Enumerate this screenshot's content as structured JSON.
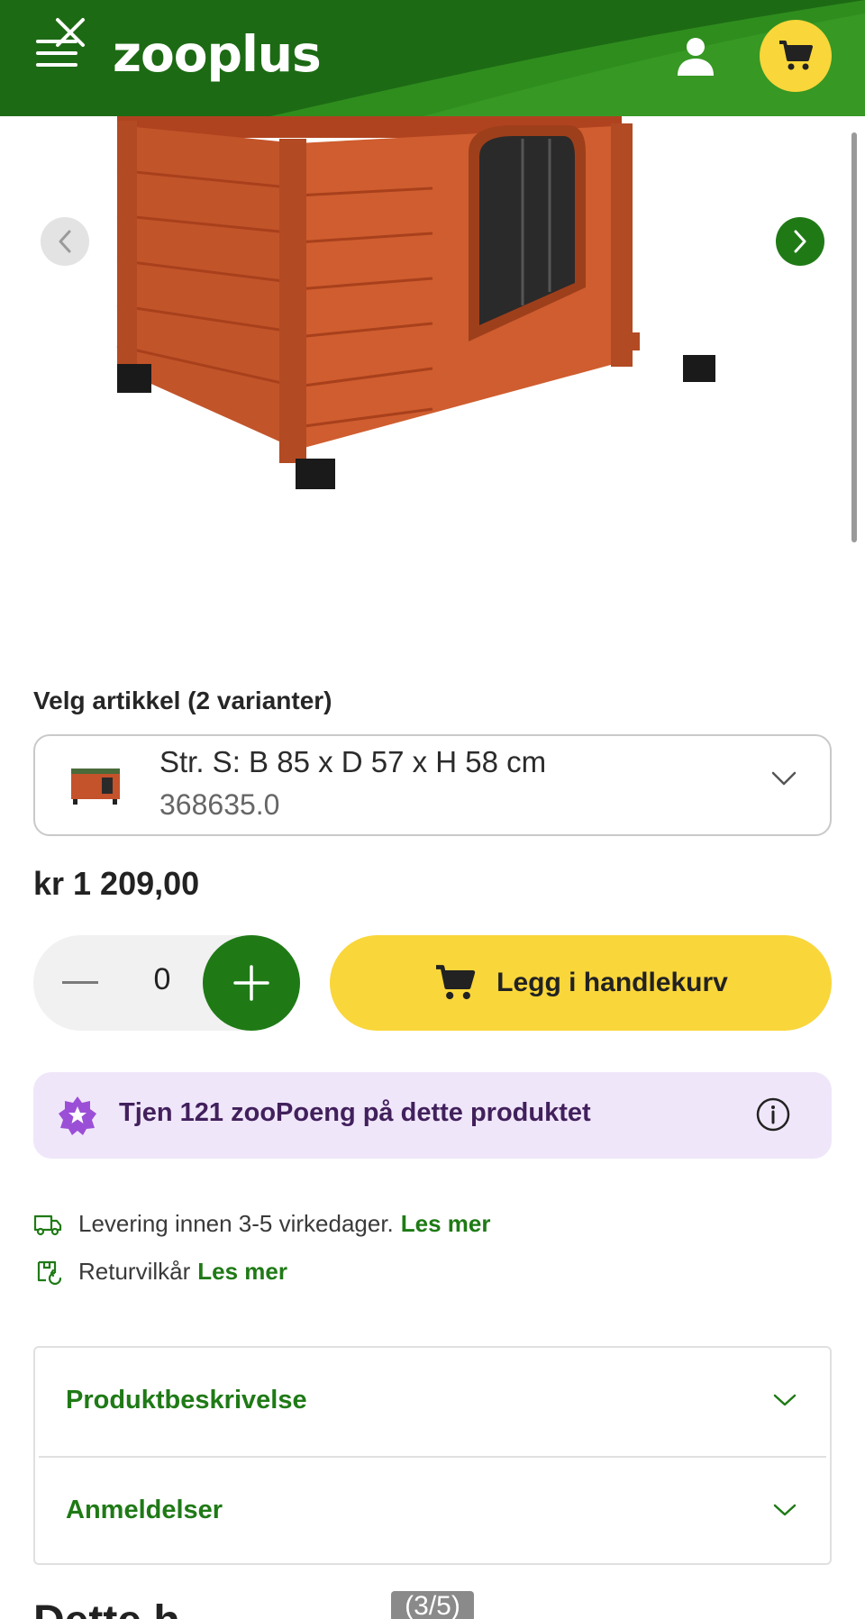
{
  "header": {
    "logo": "zooplus",
    "colors": {
      "primary": "#1d6a14",
      "accent": "#f9d63a"
    },
    "icons": [
      "close-icon",
      "menu-icon",
      "user-icon",
      "cart-icon"
    ]
  },
  "gallery": {
    "page_indicator": "(3/5)"
  },
  "variant": {
    "section_label": "Velg artikkel (2 varianter)",
    "selected_name": "Str. S: B 85 x D 57 x H 58 cm",
    "selected_number": "368635.0"
  },
  "price": "kr 1 209,00",
  "quantity": {
    "value": "0"
  },
  "add_to_cart": {
    "label": "Legg i handlekurv"
  },
  "points": {
    "text": "Tjen 121 zooPoeng på dette produktet"
  },
  "delivery": {
    "text": "Levering innen 3-5 virkedager.",
    "link": "Les mer"
  },
  "returns": {
    "text": "Returvilkår",
    "link": "Les mer"
  },
  "accordion": {
    "items": [
      {
        "label": "Produktbeskrivelse"
      },
      {
        "label": "Anmeldelser"
      }
    ]
  },
  "bottom_peek": "Dette h"
}
